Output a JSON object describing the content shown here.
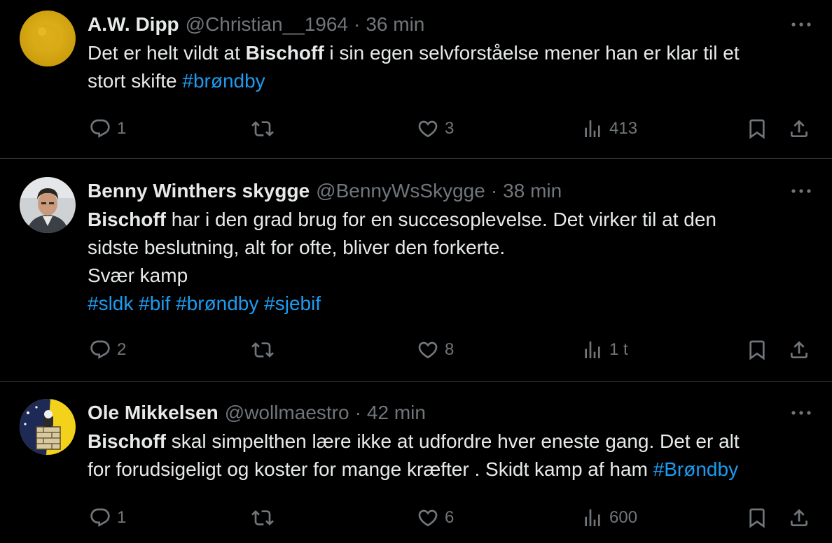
{
  "colors": {
    "background": "#000000",
    "text": "#e7e9ea",
    "muted": "#71767b",
    "hashtag": "#1d9bf0",
    "divider": "#2f3336"
  },
  "tweets": [
    {
      "name": "A.W. Dipp",
      "handle": "@Christian__1964",
      "separator": "·",
      "time": "36 min",
      "lines": [
        [
          {
            "t": "Det er helt vildt at "
          },
          {
            "t": "Bischoff",
            "s": "bold"
          },
          {
            "t": " i sin egen selvforståelse mener han er klar til et"
          }
        ],
        [
          {
            "t": "stort skifte "
          },
          {
            "t": "#brøndby",
            "s": "tag"
          }
        ]
      ],
      "replies": "1",
      "retweets": "",
      "likes": "3",
      "views": "413"
    },
    {
      "name": "Benny Winthers skygge",
      "handle": "@BennyWsSkygge",
      "separator": "·",
      "time": "38 min",
      "lines": [
        [
          {
            "t": "Bischoff",
            "s": "bold"
          },
          {
            "t": " har i den grad brug for en succesoplevelse. Det virker til at den"
          }
        ],
        [
          {
            "t": "sidste beslutning, alt for ofte, bliver den forkerte."
          }
        ],
        [
          {
            "t": "Svær kamp"
          }
        ],
        [
          {
            "t": "#sldk",
            "s": "tag"
          },
          {
            "t": " "
          },
          {
            "t": "#bif",
            "s": "tag"
          },
          {
            "t": " "
          },
          {
            "t": "#brøndby",
            "s": "tag"
          },
          {
            "t": " "
          },
          {
            "t": "#sjebif",
            "s": "tag"
          }
        ]
      ],
      "replies": "2",
      "retweets": "",
      "likes": "8",
      "views": "1 t"
    },
    {
      "name": "Ole Mikkelsen",
      "handle": "@wollmaestro",
      "separator": "·",
      "time": "42 min",
      "lines": [
        [
          {
            "t": "Bischoff",
            "s": "bold"
          },
          {
            "t": " skal simpelthen lære ikke at udfordre hver eneste gang. Det er alt"
          }
        ],
        [
          {
            "t": "for forudsigeligt og koster for mange kræfter . Skidt kamp af ham "
          },
          {
            "t": "#Brøndby",
            "s": "tag"
          }
        ]
      ],
      "replies": "1",
      "retweets": "",
      "likes": "6",
      "views": "600"
    }
  ]
}
